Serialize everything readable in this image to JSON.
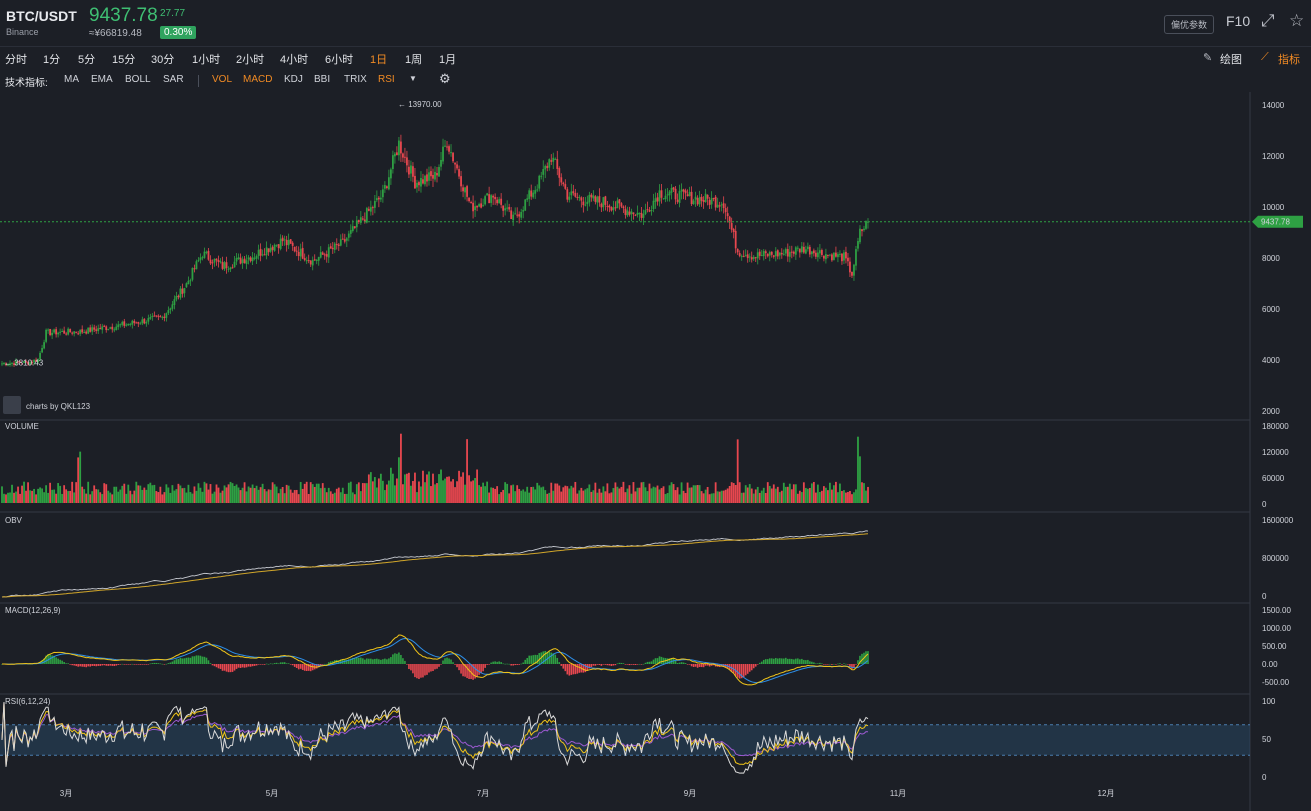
{
  "header": {
    "pair": "BTC/USDT",
    "exchange": "Binance",
    "price": "9437.78",
    "change": "27.77",
    "cny_price": "≈¥66819.48",
    "change_pct": "0.30%",
    "pref_button": "偏优参数",
    "f10": "F10"
  },
  "intervals": [
    {
      "label": "分时"
    },
    {
      "label": "1分"
    },
    {
      "label": "5分"
    },
    {
      "label": "15分"
    },
    {
      "label": "30分"
    },
    {
      "label": "1小时"
    },
    {
      "label": "2小时"
    },
    {
      "label": "4小时"
    },
    {
      "label": "6小时"
    },
    {
      "label": "1日",
      "active": true
    },
    {
      "label": "1周"
    },
    {
      "label": "1月"
    }
  ],
  "tools": {
    "draw": "绘图",
    "indicators": "指标"
  },
  "indicator_bar": {
    "label": "技术指标:",
    "items": [
      {
        "label": "MA"
      },
      {
        "label": "EMA"
      },
      {
        "label": "BOLL"
      },
      {
        "label": "SAR"
      },
      {
        "label": "VOL",
        "on": true
      },
      {
        "label": "MACD",
        "on": true
      },
      {
        "label": "KDJ"
      },
      {
        "label": "BBI"
      },
      {
        "label": "TRIX"
      },
      {
        "label": "RSI",
        "on": true
      }
    ]
  },
  "chart_data": {
    "type": "candlestick",
    "max_label": "← 13970.00",
    "min_label": "← 3810.43",
    "last_price_tag": "9437.78",
    "watermark": "charts by QKL123",
    "x_labels": [
      "3月",
      "5月",
      "7月",
      "9月",
      "11月",
      "12月"
    ],
    "price_axis": [
      "14000",
      "12000",
      "10000",
      "8000",
      "6000",
      "4000",
      "2000"
    ],
    "volume_axis": [
      "180000",
      "120000",
      "60000",
      "0"
    ],
    "obv_axis": [
      "1600000",
      "800000",
      "0"
    ],
    "macd_axis": [
      "1500.00",
      "1000.00",
      "500.00",
      "0.00",
      "-500.00"
    ],
    "rsi_axis": [
      "100",
      "50",
      "0"
    ],
    "panels": {
      "volume": "VOLUME",
      "obv": "OBV",
      "macd": "MACD(12,26,9)",
      "rsi": "RSI(6,12,24)"
    },
    "close_anchors": [
      [
        0,
        3900
      ],
      [
        14,
        3950
      ],
      [
        18,
        4050
      ],
      [
        22,
        5100
      ],
      [
        40,
        5150
      ],
      [
        60,
        5400
      ],
      [
        80,
        5700
      ],
      [
        92,
        7000
      ],
      [
        100,
        8200
      ],
      [
        110,
        7700
      ],
      [
        125,
        8100
      ],
      [
        140,
        8700
      ],
      [
        155,
        7900
      ],
      [
        170,
        8600
      ],
      [
        190,
        10500
      ],
      [
        198,
        12500
      ],
      [
        206,
        11000
      ],
      [
        216,
        11200
      ],
      [
        222,
        12600
      ],
      [
        234,
        10000
      ],
      [
        245,
        10500
      ],
      [
        255,
        9500
      ],
      [
        268,
        11000
      ],
      [
        274,
        12000
      ],
      [
        282,
        10500
      ],
      [
        290,
        10300
      ],
      [
        300,
        10200
      ],
      [
        320,
        9700
      ],
      [
        328,
        10600
      ],
      [
        342,
        10400
      ],
      [
        360,
        10200
      ],
      [
        367,
        8300
      ],
      [
        375,
        8100
      ],
      [
        390,
        8200
      ],
      [
        400,
        8400
      ],
      [
        412,
        8150
      ],
      [
        420,
        8050
      ],
      [
        424,
        7400
      ],
      [
        428,
        9000
      ],
      [
        432,
        9437
      ]
    ],
    "colors": {
      "up": "#2ea043",
      "down": "#e8474f",
      "bg": "#1c1f26",
      "dif": "#f0c419",
      "dea": "#2d8ee8",
      "rsi6": "#d9d9d9",
      "rsi12": "#f0c419",
      "rsi24": "#9b59d0",
      "obv": "#c9ccd3",
      "obv_ma": "#d1a62a"
    }
  }
}
